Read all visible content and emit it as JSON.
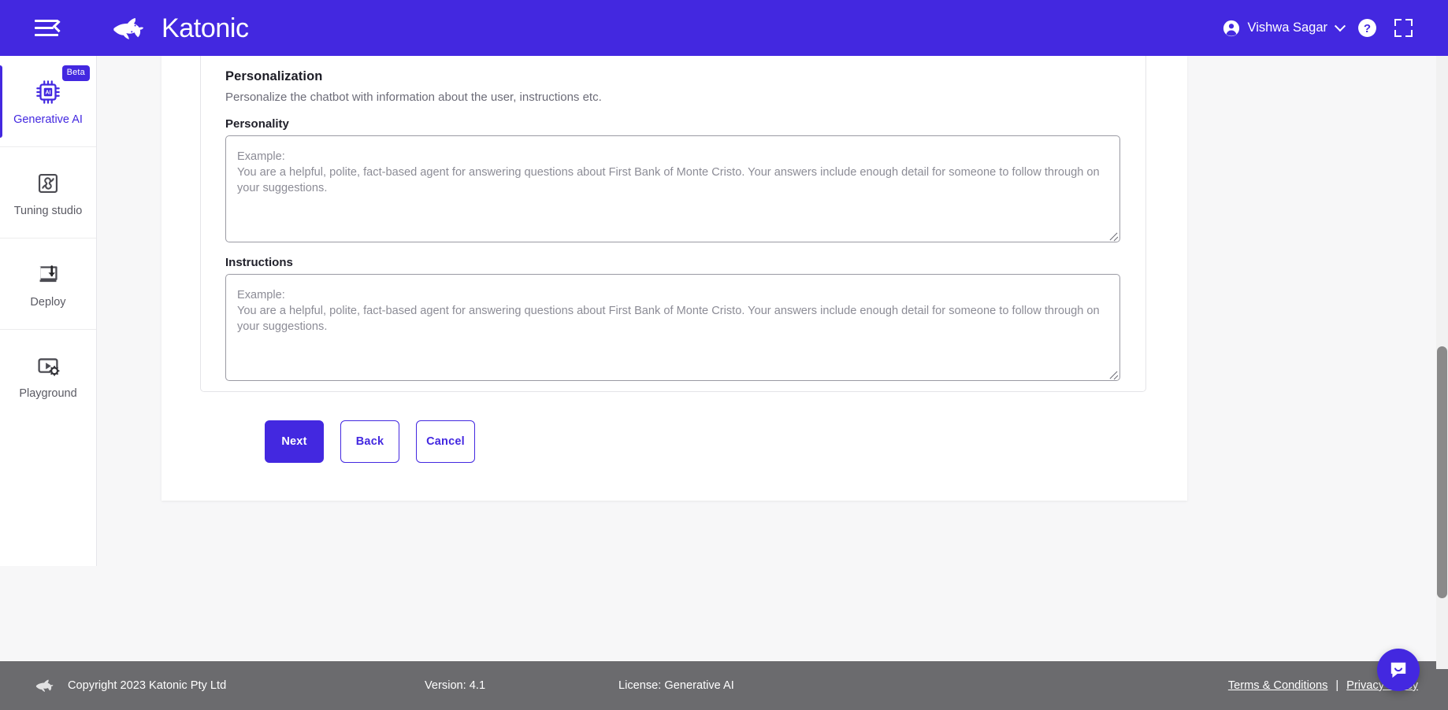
{
  "topbar": {
    "menu_icon": "hamburger-collapse-icon",
    "brand_name": "Katonic",
    "user_name": "Vishwa Sagar",
    "help_icon": "help-circle-icon",
    "fullscreen_icon": "fullscreen-expand-icon"
  },
  "sidebar": {
    "items": [
      {
        "label": "Generative AI",
        "icon": "ai-chip-icon",
        "active": true,
        "badge": "Beta"
      },
      {
        "label": "Tuning studio",
        "icon": "puzzle-icon",
        "active": false,
        "badge": ""
      },
      {
        "label": "Deploy",
        "icon": "monitor-download-icon",
        "active": false,
        "badge": ""
      },
      {
        "label": "Playground",
        "icon": "screen-play-gear-icon",
        "active": false,
        "badge": ""
      }
    ]
  },
  "main": {
    "section_title": "Personalization",
    "section_subtitle": "Personalize the chatbot with information about the user, instructions etc.",
    "fields": {
      "personality": {
        "label": "Personality",
        "value": "",
        "placeholder": "Example:\nYou are a helpful, polite, fact-based agent for answering questions about First Bank of Monte Cristo. Your answers include enough detail for someone to follow through on your suggestions."
      },
      "instructions": {
        "label": "Instructions",
        "value": "",
        "placeholder": "Example:\nYou are a helpful, polite, fact-based agent for answering questions about First Bank of Monte Cristo. Your answers include enough detail for someone to follow through on your suggestions."
      }
    },
    "buttons": {
      "next": "Next",
      "back": "Back",
      "cancel": "Cancel"
    }
  },
  "footer": {
    "copyright": "Copyright 2023 Katonic Pty Ltd",
    "version": "Version: 4.1",
    "license": "License: Generative AI",
    "terms": "Terms & Conditions",
    "separator": "|",
    "privacy": "Privacy Policy"
  },
  "widgets": {
    "chat_icon": "intercom-chat-icon"
  },
  "colors": {
    "brand_purple": "#4328e0",
    "footer_gray": "#6b6b6e",
    "page_bg": "#f7f7f8",
    "text_muted": "#6c6c78"
  }
}
